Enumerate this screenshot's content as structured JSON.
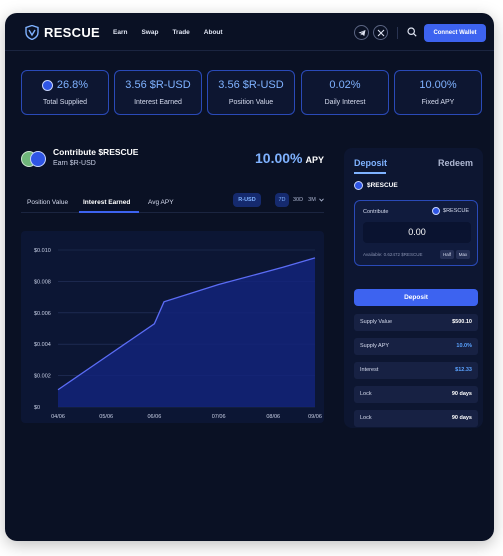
{
  "header": {
    "brand": "RESCUE",
    "nav": [
      "Earn",
      "Swap",
      "Trade",
      "About"
    ],
    "social_icons": [
      "telegram-icon",
      "x-icon"
    ],
    "connect_label": "Connect Wallet"
  },
  "stats": [
    {
      "value": "26.8%",
      "label": "Total Supplied",
      "has_icon": true
    },
    {
      "value": "3.56 $R-USD",
      "label": "Interest Earned"
    },
    {
      "value": "3.56 $R-USD",
      "label": "Position Value"
    },
    {
      "value": "0.02%",
      "label": "Daily Interest"
    },
    {
      "value": "10.00%",
      "label": "Fixed APY"
    }
  ],
  "pool": {
    "title": "Contribute $RESCUE",
    "subtitle": "Earn $R-USD",
    "apy_value": "10.00%",
    "apy_suffix": "APY"
  },
  "tabs": [
    "Position Value",
    "Interest Earned",
    "Avg APY"
  ],
  "active_tab": 1,
  "currency_pill": "R-USD",
  "ranges": [
    "7D",
    "30D",
    "3M"
  ],
  "active_range": 0,
  "chart_data": {
    "type": "area",
    "x": [
      "04/06",
      "05/06",
      "06/06",
      "07/06",
      "08/06",
      "09/06"
    ],
    "series": [
      {
        "values": [
          0.0011,
          0.0032,
          0.0053,
          0.0067,
          0.0078,
          0.0089,
          0.0095
        ]
      }
    ],
    "x_points": [
      0,
      1.5,
      3,
      3.3,
      5,
      7,
      8
    ],
    "x_tick_positions": [
      0,
      1.5,
      3,
      5,
      6.7,
      8
    ],
    "ylim": [
      0,
      0.01
    ],
    "yticks": [
      "$0",
      "$0.002",
      "$0.004",
      "$0.006",
      "$0.008",
      "$0.010"
    ],
    "line_color": "#5b6cf5",
    "fill_color": "#13237a",
    "grid": true
  },
  "deposit_panel": {
    "tab_deposit": "Deposit",
    "tab_redeem": "Redeem",
    "asset": "$RESCUE",
    "contribute_label": "Contribute",
    "contribute_asset": "$RESCUE",
    "amount": "0.00",
    "available": "Available: 0.62472 $RESCUE",
    "half": "Half",
    "max": "Max",
    "deposit_button": "Deposit",
    "rows": [
      {
        "key": "Supply Value",
        "value": "$500.10",
        "highlight": false
      },
      {
        "key": "Supply APY",
        "value": "10.0%",
        "highlight": true
      },
      {
        "key": "Interest",
        "value": "$12.33",
        "highlight": true
      },
      {
        "key": "Lock",
        "value": "90 days",
        "highlight": false
      },
      {
        "key": "Lock",
        "value": "90 days",
        "highlight": false
      }
    ]
  }
}
